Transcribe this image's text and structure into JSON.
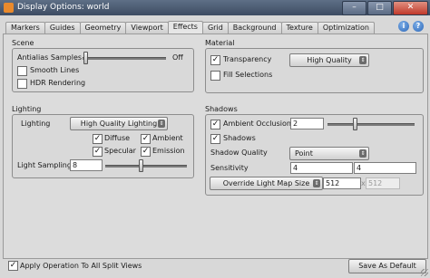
{
  "window": {
    "title": "Display Options:  world",
    "buttons": {
      "minimize": "–",
      "maximize": "□",
      "close": "✕"
    }
  },
  "tabs": [
    "Markers",
    "Guides",
    "Geometry",
    "Viewport",
    "Effects",
    "Grid",
    "Background",
    "Texture",
    "Optimization"
  ],
  "active_tab": "Effects",
  "help_icons": [
    "info-icon",
    "help-icon"
  ],
  "scene": {
    "title": "Scene",
    "antialias_label": "Antialias Samples",
    "antialias_value": "Off",
    "antialias_level": 0,
    "smooth_lines": {
      "label": "Smooth Lines",
      "checked": false
    },
    "hdr_rendering": {
      "label": "HDR Rendering",
      "checked": false
    }
  },
  "material": {
    "title": "Material",
    "transparency": {
      "label": "Transparency",
      "checked": true
    },
    "transparency_quality": "High Quality",
    "fill_selections": {
      "label": "Fill Selections",
      "checked": false
    }
  },
  "lighting": {
    "title": "Lighting",
    "lighting_label": "Lighting",
    "lighting_mode": "High Quality Lighting",
    "diffuse": {
      "label": "Diffuse",
      "checked": true
    },
    "ambient": {
      "label": "Ambient",
      "checked": true
    },
    "specular": {
      "label": "Specular",
      "checked": true
    },
    "emission": {
      "label": "Emission",
      "checked": true
    },
    "light_sampling_label": "Light Sampling",
    "light_sampling_value": "8",
    "light_sampling_level": 0.45
  },
  "shadows": {
    "title": "Shadows",
    "ambient_occlusion": {
      "label": "Ambient Occlusion",
      "checked": true
    },
    "ambient_occlusion_value": "2",
    "ambient_occlusion_level": 0.4,
    "shadows": {
      "label": "Shadows",
      "checked": true
    },
    "shadow_quality_label": "Shadow Quality",
    "shadow_quality_value": "Point",
    "sensitivity_label": "Sensitivity",
    "sensitivity_value_1": "4",
    "sensitivity_value_2": "4",
    "light_map_mode": "Override Light Map Size",
    "light_map_size_1": "512",
    "light_map_separator": "x",
    "light_map_size_2": "512"
  },
  "footer": {
    "apply_all": {
      "label": "Apply Operation To All Split Views",
      "checked": true
    },
    "save_default": "Save As Default"
  },
  "colors": {
    "titlebar": "#4a5a72",
    "panel": "#d8d8d8",
    "app_icon": "#e98a2c"
  }
}
